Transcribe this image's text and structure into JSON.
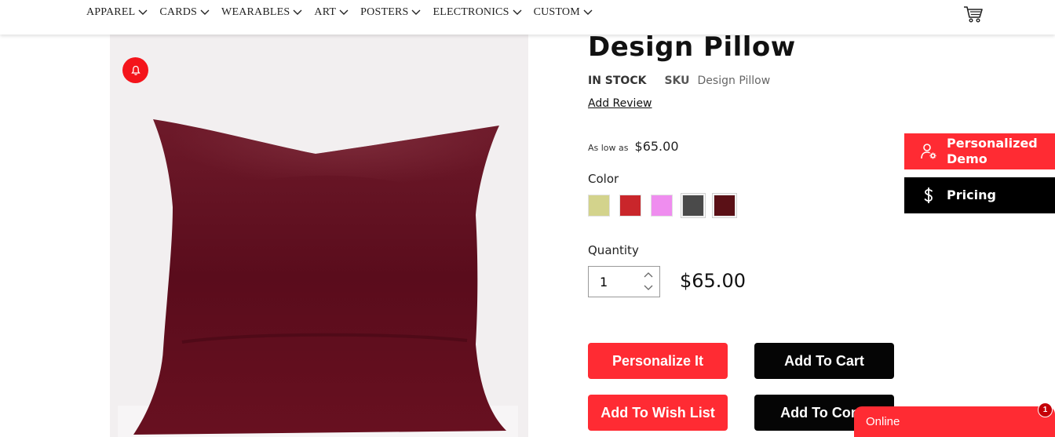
{
  "nav": {
    "items": [
      {
        "label": "APPAREL"
      },
      {
        "label": "CARDS"
      },
      {
        "label": "WEARABLES"
      },
      {
        "label": "ART"
      },
      {
        "label": "POSTERS"
      },
      {
        "label": "ELECTRONICS"
      },
      {
        "label": "CUSTOM"
      }
    ],
    "cart_icon": "shopping-cart-icon"
  },
  "product": {
    "title": "Design Pillow",
    "stock_status": "IN STOCK",
    "sku_label": "SKU",
    "sku_value": "Design Pillow",
    "add_review": "Add Review",
    "as_low_as_label": "As low as",
    "as_low_as_price": "$65.00",
    "color_label": "Color",
    "colors": [
      "#d3d38c",
      "#c9262b",
      "#ef8def",
      "#4a4a4a",
      "#5a1016"
    ],
    "pillow_color": "#6a0f1f",
    "quantity_label": "Quantity",
    "quantity_value": "1",
    "total_price": "$65.00",
    "notify_icon": "bell-icon"
  },
  "buttons": {
    "personalize": "Personalize It",
    "add_to_cart": "Add To Cart",
    "add_to_wishlist": "Add To Wish List",
    "add_to_compare": "Add To Compare"
  },
  "side": {
    "demo_label": "Personalized Demo",
    "demo_icon": "user-settings-icon",
    "pricing_label": "Pricing",
    "pricing_icon": "dollar-icon"
  },
  "chat": {
    "label": "Online",
    "badge": "1"
  },
  "colors": {
    "accent_red": "#ff2b33",
    "black": "#050505"
  }
}
